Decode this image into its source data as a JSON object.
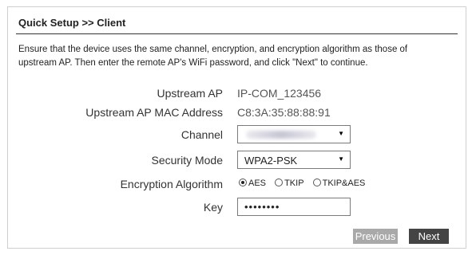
{
  "header": {
    "title": "Quick Setup >> Client"
  },
  "intro": {
    "line1": "Ensure that the device uses the same channel, encryption, and encryption algorithm as those of",
    "line2": "upstream AP. Then enter the remote AP's WiFi password, and click \"Next\" to continue."
  },
  "form": {
    "upstream_ap": {
      "label": "Upstream AP",
      "value": "IP-COM_123456"
    },
    "mac": {
      "label": "Upstream AP MAC Address",
      "value": "C8:3A:35:88:88:91"
    },
    "channel": {
      "label": "Channel",
      "value": ""
    },
    "security": {
      "label": "Security Mode",
      "value": "WPA2-PSK"
    },
    "encryption": {
      "label": "Encryption Algorithm",
      "options": [
        "AES",
        "TKIP",
        "TKIP&AES"
      ],
      "selected": "AES"
    },
    "key": {
      "label": "Key",
      "value": "••••••••"
    }
  },
  "buttons": {
    "previous": "Previous",
    "next": "Next"
  },
  "colors": {
    "next_bg": "#444444",
    "previous_bg": "#a9a9a9",
    "title_rule": "#333333"
  }
}
